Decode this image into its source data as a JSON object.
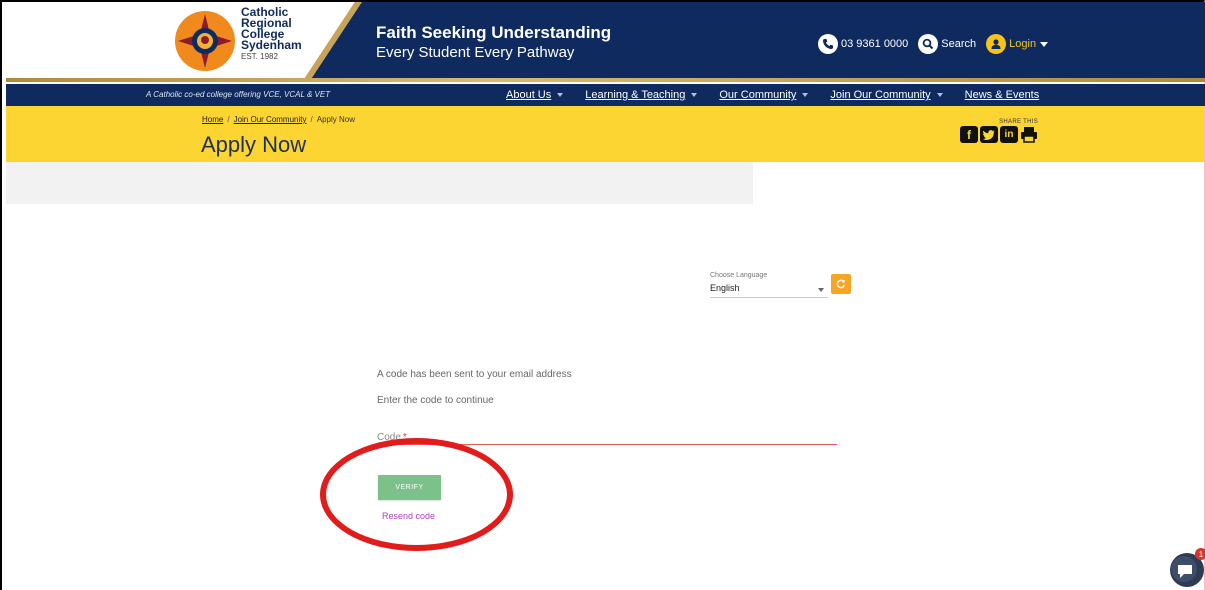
{
  "header": {
    "school_name_lines": [
      "Catholic",
      "Regional",
      "College",
      "Sydenham"
    ],
    "est": "EST. 1982",
    "tagline_1": "Faith Seeking Understanding",
    "tagline_2": "Every Student Every Pathway",
    "phone": "03 9361 0000",
    "search_label": "Search",
    "login_label": "Login"
  },
  "nav": {
    "note": "A Catholic co-ed college offering VCE, VCAL & VET",
    "items": [
      {
        "label": "About Us",
        "dropdown": true
      },
      {
        "label": "Learning & Teaching",
        "dropdown": true
      },
      {
        "label": "Our Community",
        "dropdown": true
      },
      {
        "label": "Join Our Community",
        "dropdown": true
      },
      {
        "label": "News & Events",
        "dropdown": false
      }
    ]
  },
  "banner": {
    "breadcrumb": [
      "Home",
      "Join Our Community",
      "Apply Now"
    ],
    "title": "Apply Now",
    "share_label": "SHARE THIS",
    "share_icons": [
      "facebook-icon",
      "twitter-icon",
      "linkedin-icon",
      "print-icon"
    ]
  },
  "language": {
    "label": "Choose Language",
    "selected": "English"
  },
  "form": {
    "message_1": "A code has been sent to your email address",
    "message_2": "Enter the code to continue",
    "code_label": "Code",
    "required_mark": "*",
    "verify_label": "VERIFY",
    "resend_label": "Resend code"
  },
  "chat": {
    "badge_count": "1"
  },
  "colors": {
    "navy": "#0f2a5f",
    "yellow": "#fcd533",
    "verify_green": "#7cc189",
    "annotation_red": "#e21b1b",
    "resend_purple": "#b03dc1",
    "orange": "#f6a623"
  }
}
